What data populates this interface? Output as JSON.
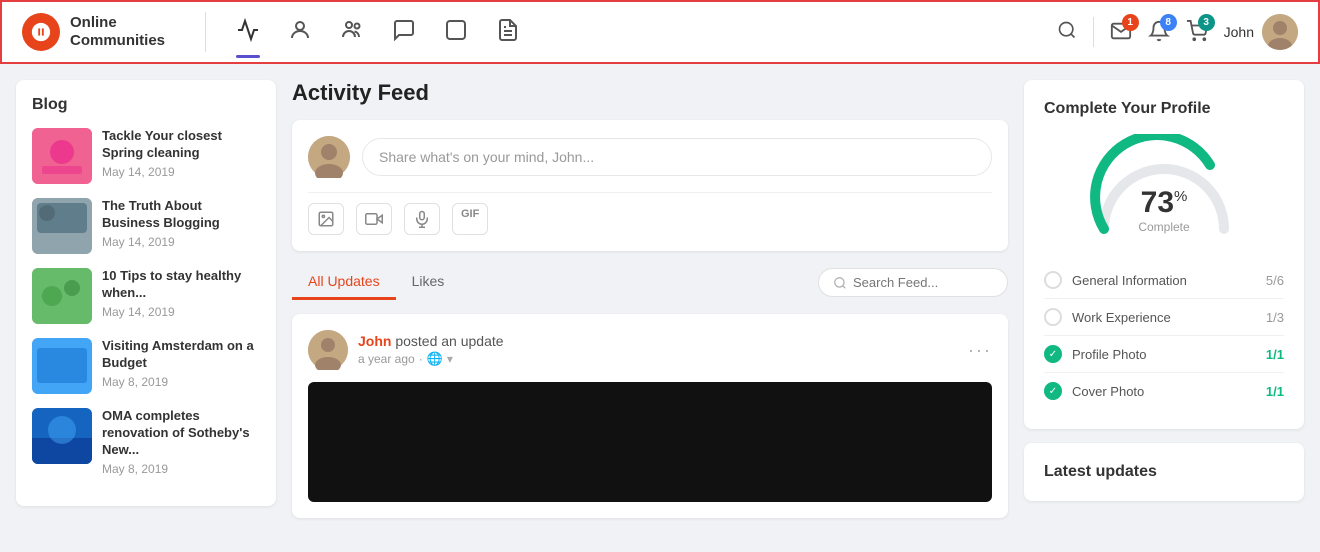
{
  "navbar": {
    "logo_text": "Online\nCommunities",
    "logo_symbol": "b",
    "nav_icons": [
      {
        "name": "activity-icon",
        "symbol": "⚡",
        "active": true
      },
      {
        "name": "profile-icon",
        "symbol": "👤",
        "active": false
      },
      {
        "name": "people-icon",
        "symbol": "👥",
        "active": false
      },
      {
        "name": "chat-icon",
        "symbol": "💬",
        "active": false
      },
      {
        "name": "media-icon",
        "symbol": "⬜",
        "active": false
      },
      {
        "name": "document-icon",
        "symbol": "📋",
        "active": false
      }
    ],
    "search_icon": "🔍",
    "notifications": [
      {
        "name": "mail-icon",
        "symbol": "✉",
        "count": "1",
        "badge_color": "orange"
      },
      {
        "name": "bell-icon",
        "symbol": "🔔",
        "count": "8",
        "badge_color": "blue"
      },
      {
        "name": "cart-icon",
        "symbol": "🛒",
        "count": "3",
        "badge_color": "teal"
      }
    ],
    "user_name": "John"
  },
  "sidebar": {
    "title": "Blog",
    "items": [
      {
        "title": "Tackle Your closest Spring cleaning",
        "date": "May 14, 2019",
        "color": "pink"
      },
      {
        "title": "The Truth About Business Blogging",
        "date": "May 14, 2019",
        "color": "gray"
      },
      {
        "title": "10 Tips to stay healthy when...",
        "date": "May 14, 2019",
        "color": "green"
      },
      {
        "title": "Visiting Amsterdam on a Budget",
        "date": "May 8, 2019",
        "color": "blue"
      },
      {
        "title": "OMA completes renovation of Sotheby's New...",
        "date": "May 8, 2019",
        "color": "dark-blue"
      }
    ]
  },
  "feed": {
    "title": "Activity Feed",
    "post_placeholder": "Share what's on your mind, John...",
    "tabs": [
      {
        "label": "All Updates",
        "active": true
      },
      {
        "label": "Likes",
        "active": false
      }
    ],
    "search_placeholder": "Search Feed...",
    "post": {
      "user": "John",
      "action": " posted an update",
      "time": "a year ago",
      "more": "···"
    }
  },
  "profile_completion": {
    "title": "Complete Your Profile",
    "percent": "73",
    "percent_symbol": "%",
    "label": "Complete",
    "items": [
      {
        "name": "General Information",
        "score": "5/6",
        "complete": false
      },
      {
        "name": "Work Experience",
        "score": "1/3",
        "complete": false
      },
      {
        "name": "Profile Photo",
        "score": "1/1",
        "complete": true
      },
      {
        "name": "Cover Photo",
        "score": "1/1",
        "complete": true
      }
    ]
  },
  "latest": {
    "title": "Latest updates"
  }
}
